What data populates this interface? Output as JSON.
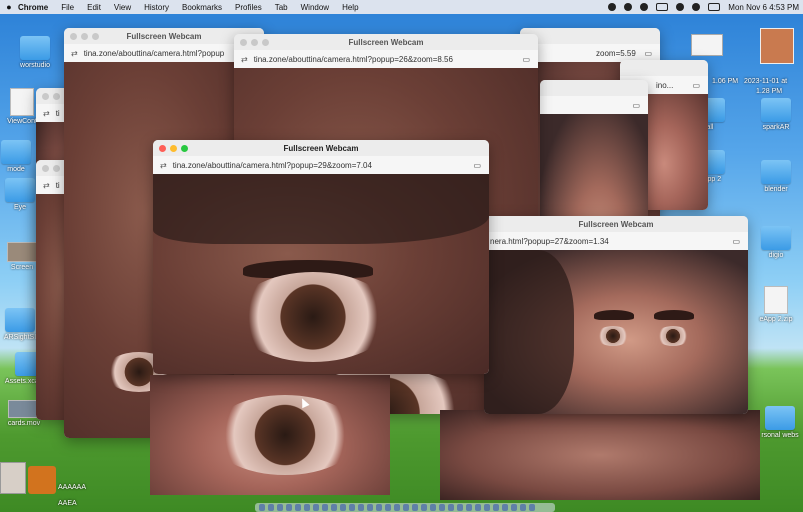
{
  "menubar": {
    "apple": "",
    "items": [
      "Chrome",
      "File",
      "Edit",
      "View",
      "History",
      "Bookmarks",
      "Profiles",
      "Tab",
      "Window",
      "Help"
    ],
    "clock": "Mon Nov 6  4:53 PM"
  },
  "desktop_icons_left": [
    {
      "label": "worstudio"
    },
    {
      "label": "ViewCont"
    },
    {
      "label": "mode"
    },
    {
      "label": "Eye"
    },
    {
      "label": "Screen"
    },
    {
      "label": "ARSightSI"
    },
    {
      "label": "Assets.xcassets"
    },
    {
      "label": "cards.mov"
    }
  ],
  "desktop_icons_right": [
    {
      "label": "all"
    },
    {
      "label": "sparkAR"
    },
    {
      "label": "eApp 2"
    },
    {
      "label": "blender"
    },
    {
      "label": "digio"
    },
    {
      "label": "eApp 2.zip"
    },
    {
      "label": "rsonal webs"
    }
  ],
  "desktop_side_texts": {
    "screenshot_time": "1.06 PM",
    "stamp_1": "2023-11-01 at",
    "stamp_2": "1.28 PM",
    "footer_1": "AAAAAA",
    "footer_2": "AAEA"
  },
  "windows": [
    {
      "title": "Fullscreen Webcam",
      "url": "tina.zone/abouttina/camera.html?popup",
      "extra": ""
    },
    {
      "title": "Fullscreen Webcam",
      "url": "tina.zone/abouttina/camera.html?popup=26&zoom=8.56",
      "extra": ""
    },
    {
      "title": "",
      "url": "zoom=5.59",
      "extra": ""
    },
    {
      "title": "",
      "url": "ino...",
      "extra": ""
    },
    {
      "title": "Fullscreen Webcam",
      "url": "tina.zone/abouttina/camera.html?popup=29&zoom=7.04",
      "extra": ""
    },
    {
      "title": "Fullscreen Webcam",
      "url": "nera.html?popup=27&zoom=1.34",
      "extra": ""
    },
    {
      "title": "",
      "url": "ti",
      "extra": ""
    },
    {
      "title": "",
      "url": "ti",
      "extra": ""
    }
  ]
}
